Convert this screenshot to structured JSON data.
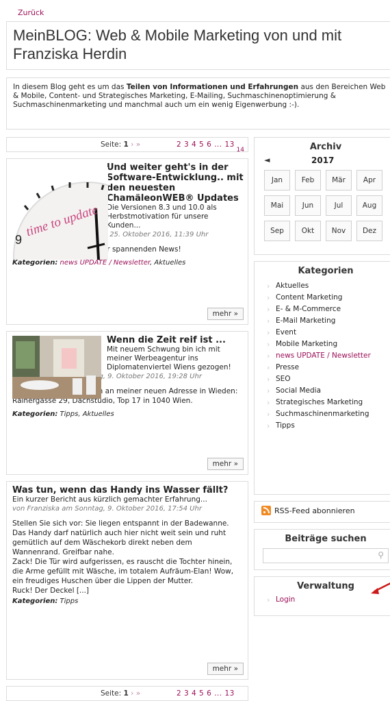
{
  "nav": {
    "back": "Zurück"
  },
  "title": "MeinBLOG: Web & Mobile Marketing von und mit Franziska Herdin",
  "intro": {
    "before": "In diesem Blog geht es um das ",
    "bold": "Teilen von Informationen und Erfahrungen",
    "after": " aus den Bereichen Web & Mobile, Content- und Strategisches Marketing, E-Mailing, Suchmaschinenoptimierung & Suchmaschinenmarketing und manchmal auch um ein wenig Eigenwerbung :-)."
  },
  "pager": {
    "label": "Seite:",
    "current": "1",
    "arrows": "› »",
    "pages": "2 3 4 5 6 ... 13",
    "extra": "14"
  },
  "posts": [
    {
      "title": "Und weiter geht's in der Software-Entwicklung.. mit den neuesten ChamäleonWEB® Updates",
      "teaser": "Die Versionen 8.3 und 10.0 als Herbstmotivation für unsere Kunden...",
      "meta": "von Franziska am Dienstag, 25. Oktober 2016, 11:39 Uhr",
      "body": "Viel Freude beim Lesen der spannenden News!",
      "cats_label": "Kategorien:",
      "cat_link": "news UPDATE / Newsletter",
      "cat_rest": ", Aktuelles",
      "more": "mehr »",
      "image_text": "time to update"
    },
    {
      "title": "Wenn die Zeit reif ist ...",
      "teaser": "Mit neuem Schwung bin ich mit meiner Werbeagentur ins Diplomatenviertel Wiens gezogen!",
      "meta": "von Franziska am Sonntag, 9. Oktober 2016, 19:28 Uhr",
      "body": "Ab sofort finden Sie mich an meiner neuen Adresse in Wieden: Rainergasse 29, Dachstudio, Top 17 in 1040 Wien.",
      "cats_label": "Kategorien:",
      "cat_rest": "Tipps, Aktuelles",
      "more": "mehr »"
    },
    {
      "title": "Was tun, wenn das Handy ins Wasser fällt?",
      "teaser": "Ein kurzer Bericht aus kürzlich gemachter Erfahrung...",
      "meta": "von Franziska am Sonntag, 9. Oktober 2016, 17:54 Uhr",
      "body": "Stellen Sie sich vor: Sie liegen entspannt in der Badewanne. Das Handy darf natürlich auch hier nicht weit sein und ruht gemütlich auf dem Wäschekorb direkt neben dem Wannenrand. Greifbar nahe.\nZack! Die Tür wird aufgerissen, es rauscht die Tochter hinein, die Arme gefüllt mit Wäsche, im totalem Aufräum-Elan! Wow, ein freudiges Huschen über die Lippen der Mutter.\nRuck! Der Deckel [...]",
      "cats_label": "Kategorien:",
      "cat_rest": "Tipps",
      "more": "mehr »"
    }
  ],
  "archive": {
    "title": "Archiv",
    "prev": "◄",
    "year": "2017",
    "months": [
      "Jan",
      "Feb",
      "Mär",
      "Apr",
      "Mai",
      "Jun",
      "Jul",
      "Aug",
      "Sep",
      "Okt",
      "Nov",
      "Dez"
    ]
  },
  "categories": {
    "title": "Kategorien",
    "items": [
      "Aktuelles",
      "Content Marketing",
      "E- & M-Commerce",
      "E-Mail Marketing",
      "Event",
      "Mobile Marketing",
      "news UPDATE / Newsletter",
      "Presse",
      "SEO",
      "Social Media",
      "Strategisches Marketing",
      "Suchmaschinenmarketing",
      "Tipps"
    ],
    "active_index": 6
  },
  "rss": {
    "label": "RSS-Feed abonnieren"
  },
  "search": {
    "title": "Beiträge suchen",
    "placeholder": ""
  },
  "admin": {
    "title": "Verwaltung",
    "login": "Login"
  },
  "colors": {
    "accent": "#9a0f56",
    "annotation_arrow": "#cc1a1a",
    "rss": "#f08a24"
  }
}
